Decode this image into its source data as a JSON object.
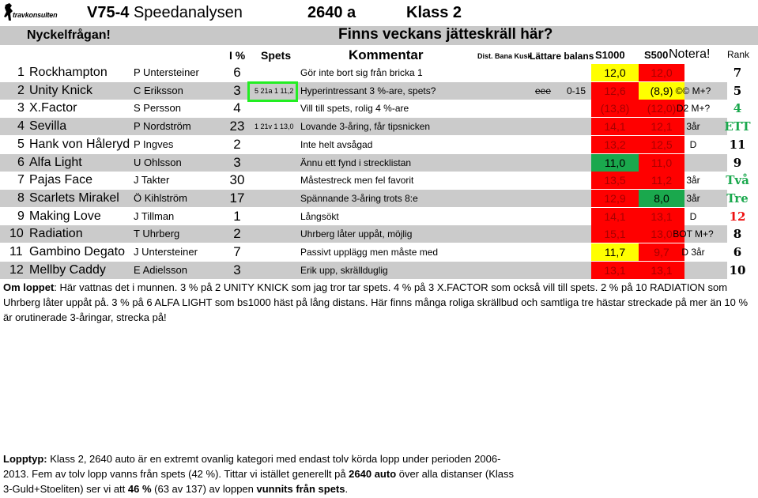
{
  "header": {
    "logo_text": "travkonsulten",
    "race_code": "V75-4",
    "race_title": "Speedanalysen",
    "distance": "2640 a",
    "class": "Klass 2",
    "key_question_label": "Nyckelfrågan!",
    "key_question": "Finns veckans jätteskräll här?"
  },
  "columns": {
    "pct": "I %",
    "spets": "Spets",
    "kommentar": "Kommentar",
    "dist_bana_kusk": "Dist. Bana Kusk",
    "lattare_balans": "Lättare balans",
    "s1000": "S1000",
    "s500": "S500",
    "notera": "Notera!",
    "rank": "Rank"
  },
  "horses": [
    {
      "num": "1",
      "name": "Rockhampton",
      "driver": "P Untersteiner",
      "pct": "6",
      "spets": "",
      "comment": "Gör inte bort sig från bricka 1",
      "dbk": "",
      "balans": "",
      "s1000": "12,0",
      "s1000_bg": "yellow",
      "s500": "12,0",
      "s500_bg": "red",
      "notera": "",
      "rank": "7",
      "rank_color": "#000000"
    },
    {
      "num": "2",
      "name": "Unity Knick",
      "driver": "C Eriksson",
      "pct": "3",
      "spets": "5 21a 1 11,2",
      "comment": "Hyperintressant 3 %-are, spets?",
      "dbk": "eee",
      "balans": "0-15",
      "s1000": "12,6",
      "s1000_bg": "red",
      "s500": "(8,9)",
      "s500_bg": "yellow",
      "notera": "©© M+?",
      "rank": "5",
      "rank_color": "#000000"
    },
    {
      "num": "3",
      "name": "X.Factor",
      "driver": "S Persson",
      "pct": "4",
      "spets": "",
      "comment": "Vill till spets, rolig 4 %-are",
      "dbk": "",
      "balans": "",
      "s1000": "(13,8)",
      "s1000_bg": "red",
      "s500": "(12,0)",
      "s500_bg": "red",
      "notera": "D2 M+?",
      "rank": "4",
      "rank_color": "#1aa84d"
    },
    {
      "num": "4",
      "name": "Sevilla",
      "driver": "P Nordström",
      "pct": "23",
      "spets": "1 21v 1 13,0",
      "comment": "Lovande 3-åring, får tipsnicken",
      "dbk": "",
      "balans": "",
      "s1000": "14,1",
      "s1000_bg": "red",
      "s500": "12,1",
      "s500_bg": "red",
      "notera": "3år",
      "rank": "ETT",
      "rank_color": "#1aa84d"
    },
    {
      "num": "5",
      "name": "Hank von Håleryd",
      "driver": "P Ingves",
      "pct": "2",
      "spets": "",
      "comment": "Inte helt avsågad",
      "dbk": "",
      "balans": "",
      "s1000": "13,2",
      "s1000_bg": "red",
      "s500": "12,5",
      "s500_bg": "red",
      "notera": "D",
      "rank": "11",
      "rank_color": "#000000"
    },
    {
      "num": "6",
      "name": "Alfa Light",
      "driver": "U Ohlsson",
      "pct": "3",
      "spets": "",
      "comment": "Ännu ett fynd i strecklistan",
      "dbk": "",
      "balans": "",
      "s1000": "11,0",
      "s1000_bg": "green",
      "s500": "11,0",
      "s500_bg": "red",
      "notera": "",
      "rank": "9",
      "rank_color": "#000000"
    },
    {
      "num": "7",
      "name": "Pajas Face",
      "driver": "J Takter",
      "pct": "30",
      "spets": "",
      "comment": "Måstestreck men fel favorit",
      "dbk": "",
      "balans": "",
      "s1000": "13,5",
      "s1000_bg": "red",
      "s500": "11,2",
      "s500_bg": "red",
      "notera": "3år",
      "rank": "Två",
      "rank_color": "#1aa84d"
    },
    {
      "num": "8",
      "name": "Scarlets Mirakel",
      "driver": "Ö Kihlström",
      "pct": "17",
      "spets": "",
      "comment": "Spännande 3-åring trots 8:e",
      "dbk": "",
      "balans": "",
      "s1000": "12,9",
      "s1000_bg": "red",
      "s500": "8,0",
      "s500_bg": "green",
      "notera": "3år",
      "rank": "Tre",
      "rank_color": "#1aa84d"
    },
    {
      "num": "9",
      "name": "Making Love",
      "driver": "J Tillman",
      "pct": "1",
      "spets": "",
      "comment": "Långsökt",
      "dbk": "",
      "balans": "",
      "s1000": "14,1",
      "s1000_bg": "red",
      "s500": "13,1",
      "s500_bg": "red",
      "notera": "D",
      "rank": "12",
      "rank_color": "#ee1111"
    },
    {
      "num": "10",
      "name": "Radiation",
      "driver": "T Uhrberg",
      "pct": "2",
      "spets": "",
      "comment": "Uhrberg låter uppåt, möjlig",
      "dbk": "",
      "balans": "",
      "s1000": "15,1",
      "s1000_bg": "red",
      "s500": "13,0",
      "s500_bg": "red",
      "notera": "BOT M+?",
      "rank": "8",
      "rank_color": "#000000"
    },
    {
      "num": "11",
      "name": "Gambino Degato",
      "driver": "J Untersteiner",
      "pct": "7",
      "spets": "",
      "comment": "Passivt upplägg men måste med",
      "dbk": "",
      "balans": "",
      "s1000": "11,7",
      "s1000_bg": "yellow",
      "s500": "9,7",
      "s500_bg": "red",
      "notera": "D 3år",
      "rank": "6",
      "rank_color": "#000000"
    },
    {
      "num": "12",
      "name": "Mellby Caddy",
      "driver": "E Adielsson",
      "pct": "3",
      "spets": "",
      "comment": "Erik upp, skrällduglig",
      "dbk": "",
      "balans": "",
      "s1000": "13,1",
      "s1000_bg": "red",
      "s500": "13,1",
      "s500_bg": "red",
      "notera": "",
      "rank": "10",
      "rank_color": "#000000"
    }
  ],
  "om_loppet": {
    "label": "Om loppet",
    "text": ": Här vattnas det i munnen. 3 % på 2 UNITY KNICK som jag tror tar spets. 4 % på 3 X.FACTOR som också vill till spets. 2 % på 10 RADIATION som Uhrberg låter uppåt på. 3 % på 6 ALFA LIGHT som bs1000 häst på lång distans. Här finns många roliga skrällbud och samtliga tre hästar streckade på mer än 10 % är orutinerade 3-åringar, strecka på!"
  },
  "lopptyp": {
    "label": "Lopptyp:",
    "text1": " Klass 2, 2640 auto är en extremt ovanlig kategori med endast tolv körda lopp under perioden 2006-2013. Fem av tolv lopp vanns från spets (42 %). Tittar vi istället generellt på ",
    "bold1": "2640 auto",
    "text2": " över alla distanser (Klass 3-Guld+Stoeliten) ser vi att ",
    "bold2": "46 %",
    "text3": " (63 av 137) av loppen ",
    "bold3": "vunnits från spets",
    "text4": "."
  }
}
